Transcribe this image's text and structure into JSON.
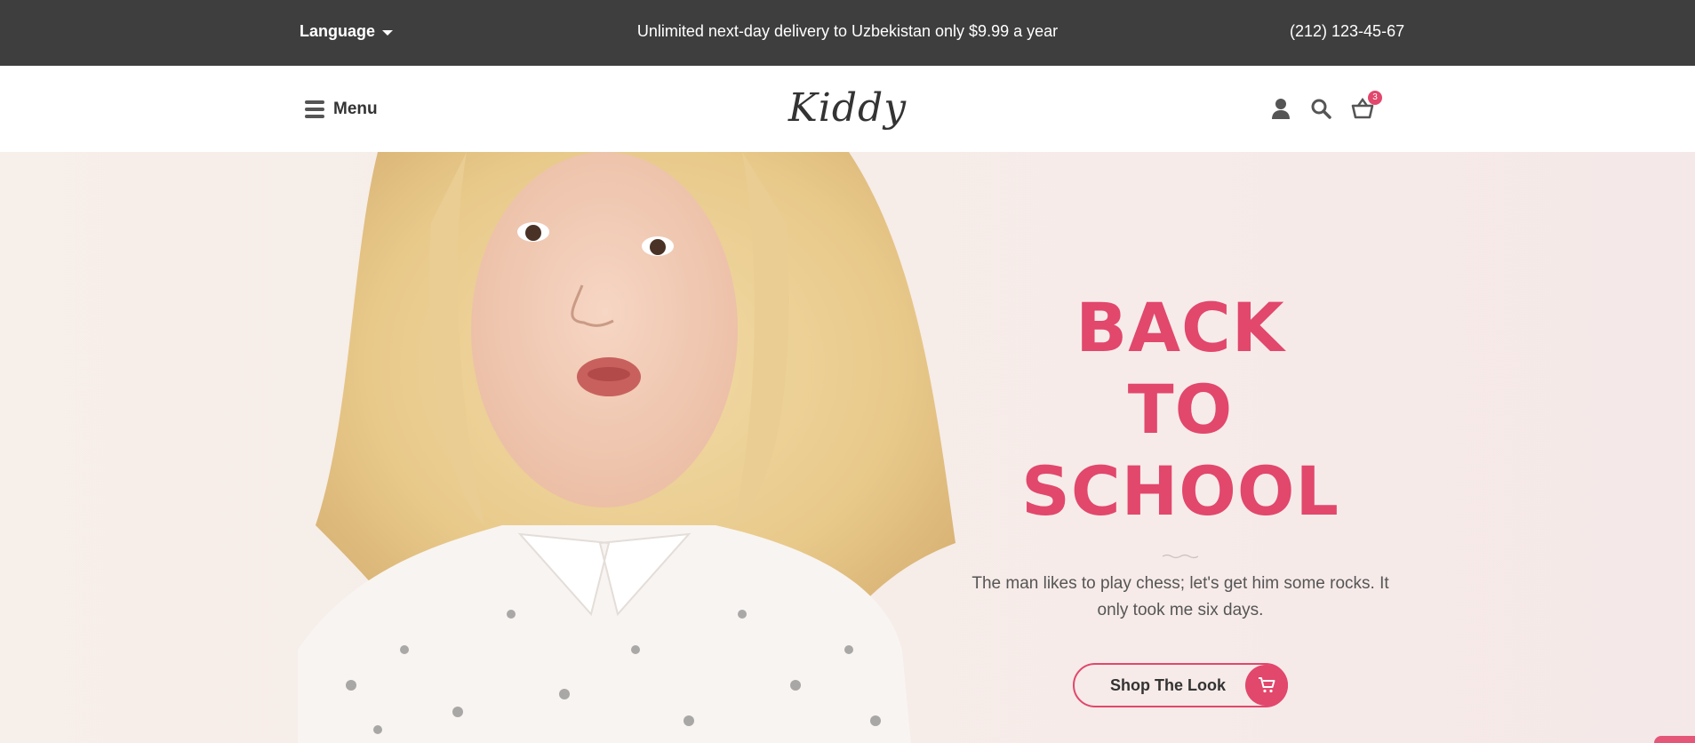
{
  "topbar": {
    "language_label": "Language",
    "promo_text": "Unlimited next-day delivery to Uzbekistan only $9.99 a year",
    "phone": "(212) 123-45-67"
  },
  "header": {
    "menu_label": "Menu",
    "logo_text": "Kiddy",
    "icons": [
      "user-icon",
      "search-icon",
      "basket-icon"
    ],
    "cart_count": "3"
  },
  "hero": {
    "title_line1": "BACK",
    "title_line2": "TO SCHOOL",
    "description": "The man likes to play chess; let's get him some rocks. It only took me six days.",
    "cta_label": "Shop The Look",
    "cta_icon": "cart-icon"
  },
  "colors": {
    "accent": "#e2476c",
    "topbar_bg": "#3e3e3e",
    "hero_bg": "#f6ece7"
  }
}
